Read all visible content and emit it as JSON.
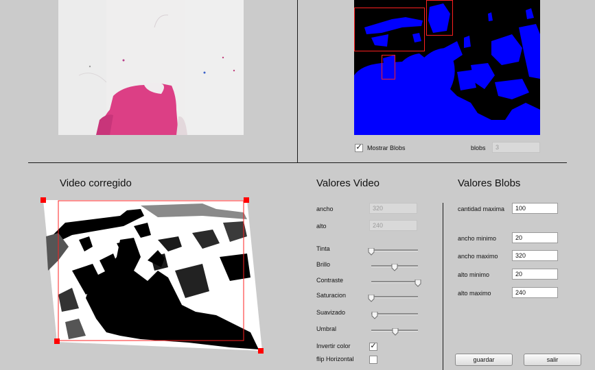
{
  "blobs_panel": {
    "mostrar_blobs_label": "Mostrar Blobs",
    "mostrar_blobs_checked": true,
    "blobs_label": "blobs",
    "blobs_value": "3"
  },
  "corrected_panel": {
    "title": "Video corregido"
  },
  "video_values": {
    "title": "Valores Video",
    "ancho_label": "ancho",
    "ancho_value": "320",
    "alto_label": "alto",
    "alto_value": "240",
    "sliders": [
      {
        "label": "Tinta",
        "value": 0.0
      },
      {
        "label": "Brillo",
        "value": 0.5
      },
      {
        "label": "Contraste",
        "value": 1.0
      },
      {
        "label": "Saturacion",
        "value": 0.0
      },
      {
        "label": "Suavizado",
        "value": 0.07
      },
      {
        "label": "Umbral",
        "value": 0.52
      }
    ],
    "invertir_label": "Invertir color",
    "invertir_checked": true,
    "flip_label": "flip Horizontal",
    "flip_checked": false
  },
  "blob_values": {
    "title": "Valores Blobs",
    "cantidad_label": "cantidad maxima",
    "cantidad_value": "100",
    "ancho_min_label": "ancho minimo",
    "ancho_min_value": "20",
    "ancho_max_label": "ancho maximo",
    "ancho_max_value": "320",
    "alto_min_label": "alto minimo",
    "alto_min_value": "20",
    "alto_max_label": "alto maximo",
    "alto_max_value": "240",
    "guardar_label": "guardar",
    "salir_label": "salir"
  }
}
